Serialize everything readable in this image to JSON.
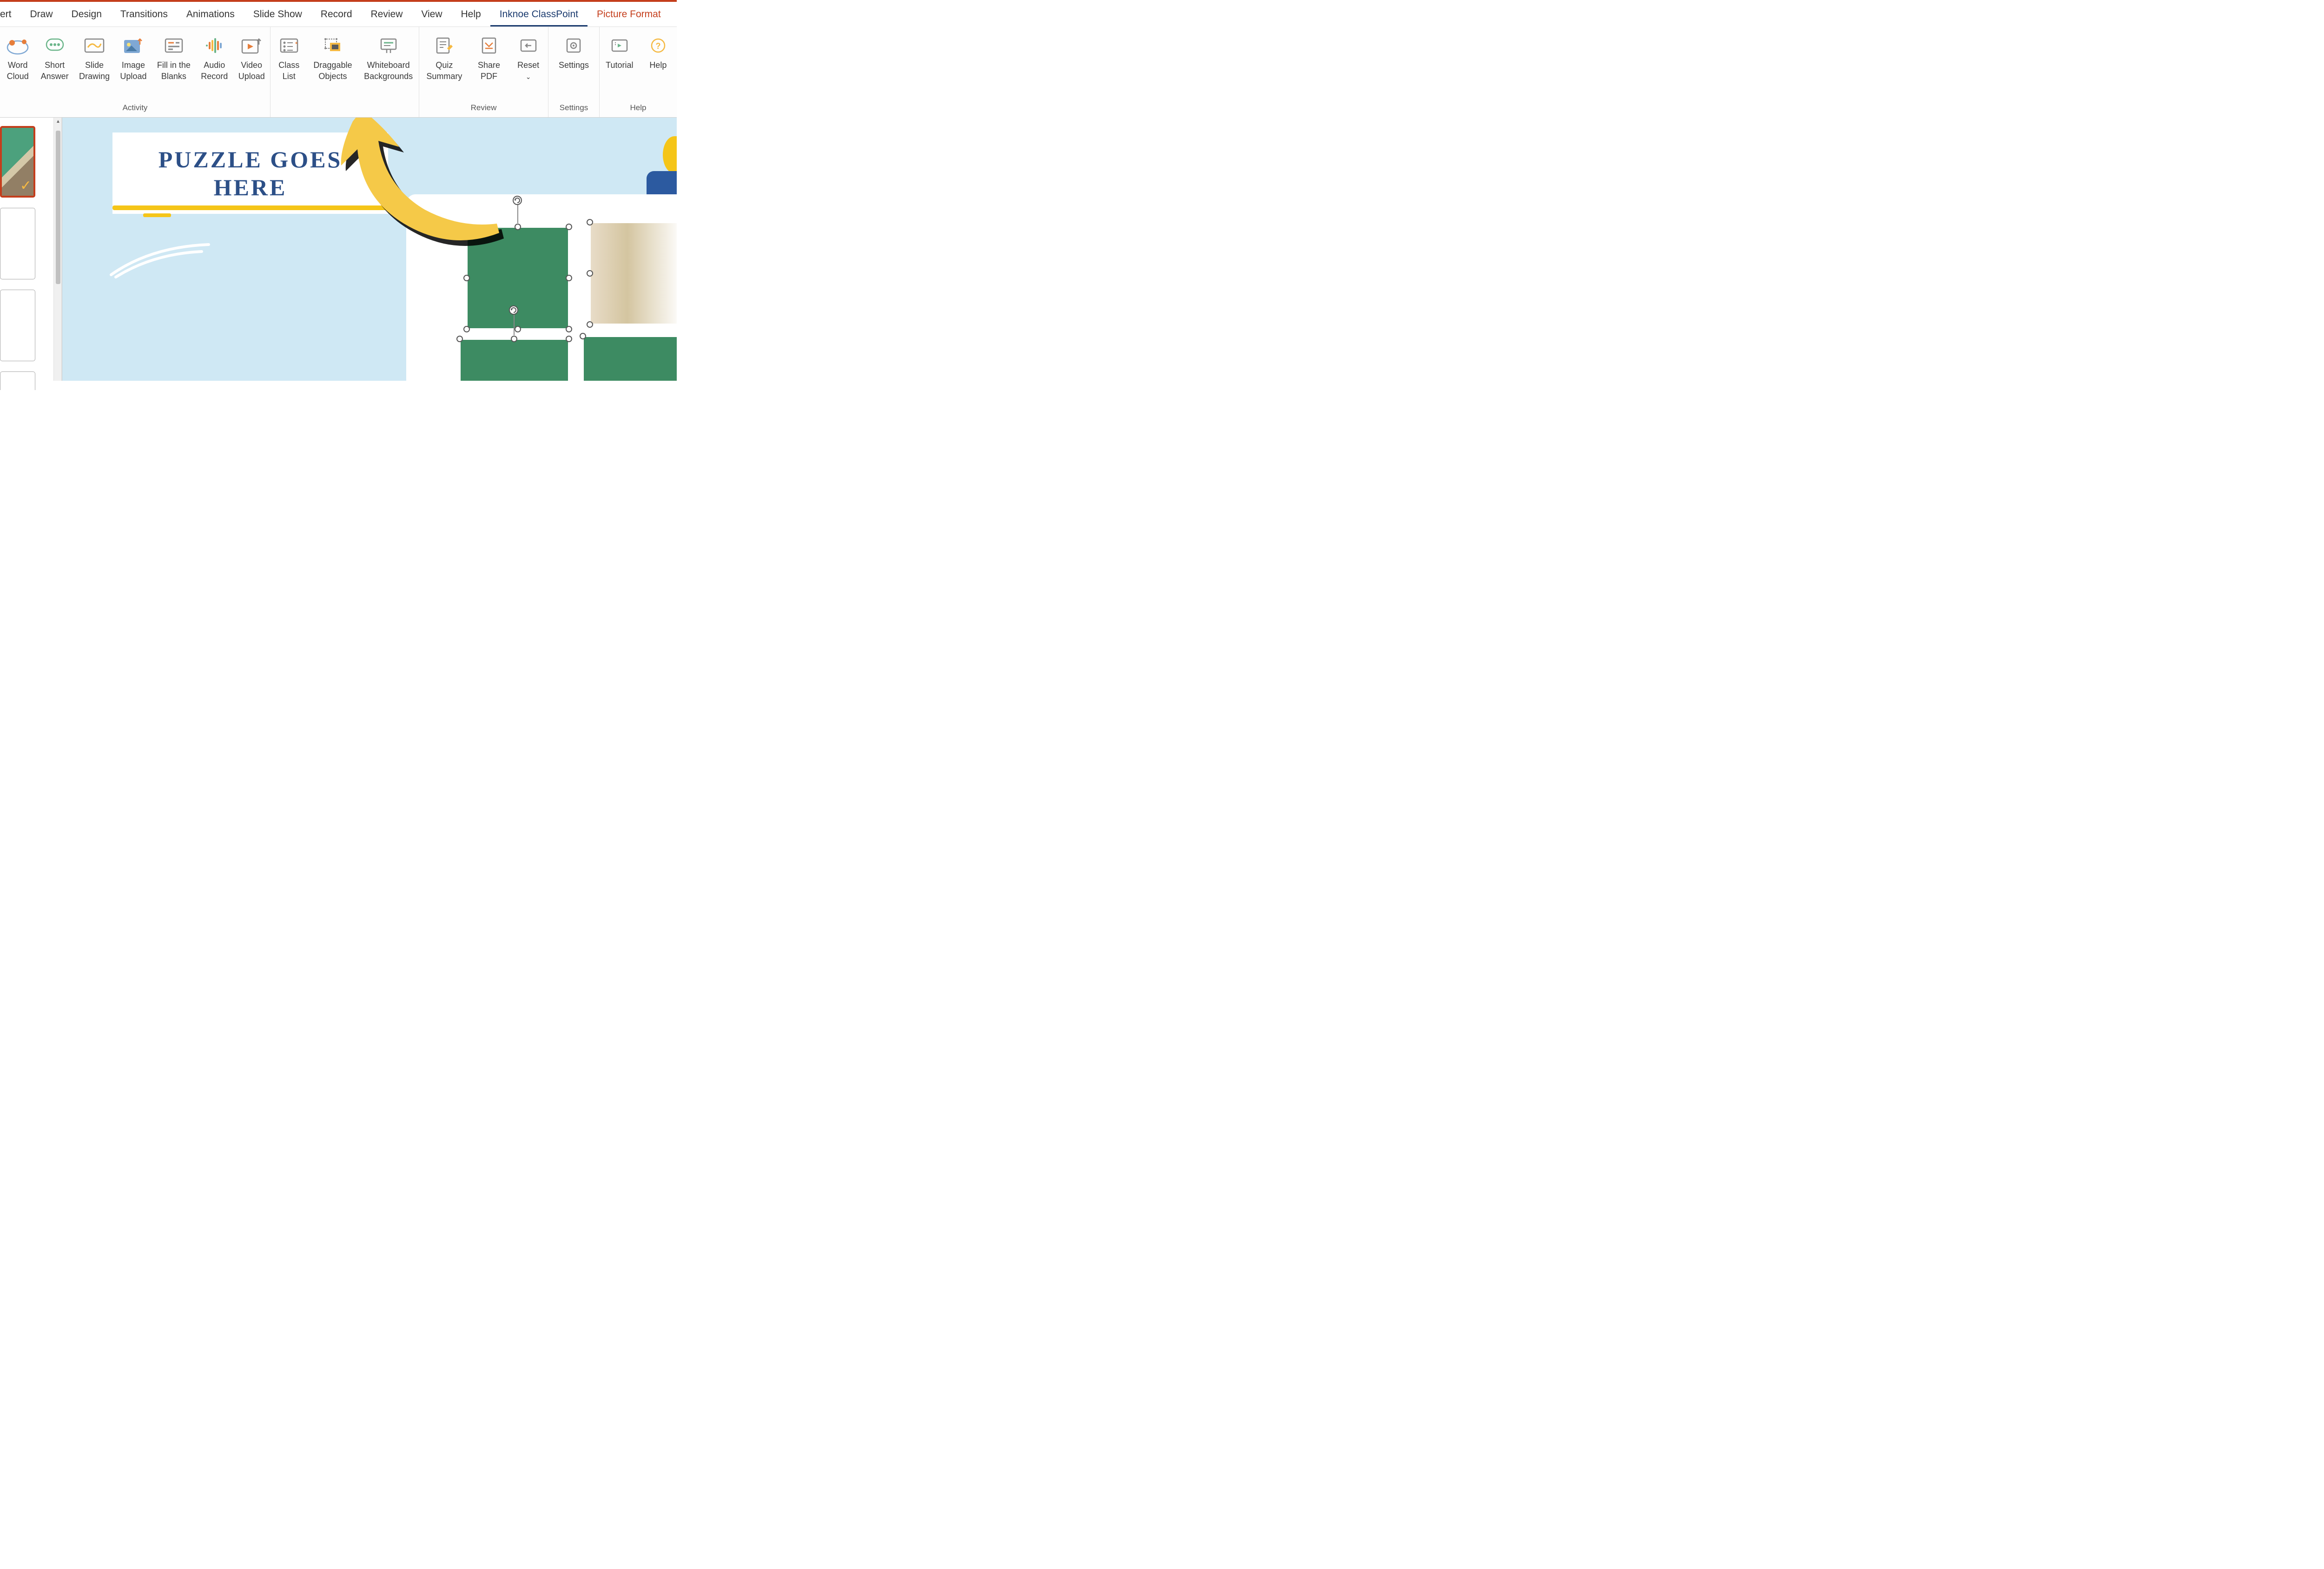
{
  "tabs": {
    "t0": "ert",
    "t1": "Draw",
    "t2": "Design",
    "t3": "Transitions",
    "t4": "Animations",
    "t5": "Slide Show",
    "t6": "Record",
    "t7": "Review",
    "t8": "View",
    "t9": "Help",
    "t10": "Inknoe ClassPoint",
    "t11": "Picture Format"
  },
  "ribbon": {
    "word_cloud": "Word\nCloud",
    "short_answer": "Short\nAnswer",
    "slide_drawing": "Slide\nDrawing",
    "image_upload": "Image\nUpload",
    "fill_blanks": "Fill in the\nBlanks",
    "audio_record": "Audio\nRecord",
    "video_upload": "Video\nUpload",
    "class_list": "Class\nList",
    "draggable": "Draggable\nObjects",
    "whiteboard": "Whiteboard\nBackgrounds",
    "quiz_summary": "Quiz\nSummary",
    "share_pdf": "Share\nPDF",
    "reset": "Reset",
    "settings": "Settings",
    "tutorial": "Tutorial",
    "help": "Help"
  },
  "groups": {
    "activity": "Activity",
    "review": "Review",
    "settings": "Settings",
    "help": "Help"
  },
  "slide": {
    "title": "PUZZLE GOES\nHERE"
  }
}
